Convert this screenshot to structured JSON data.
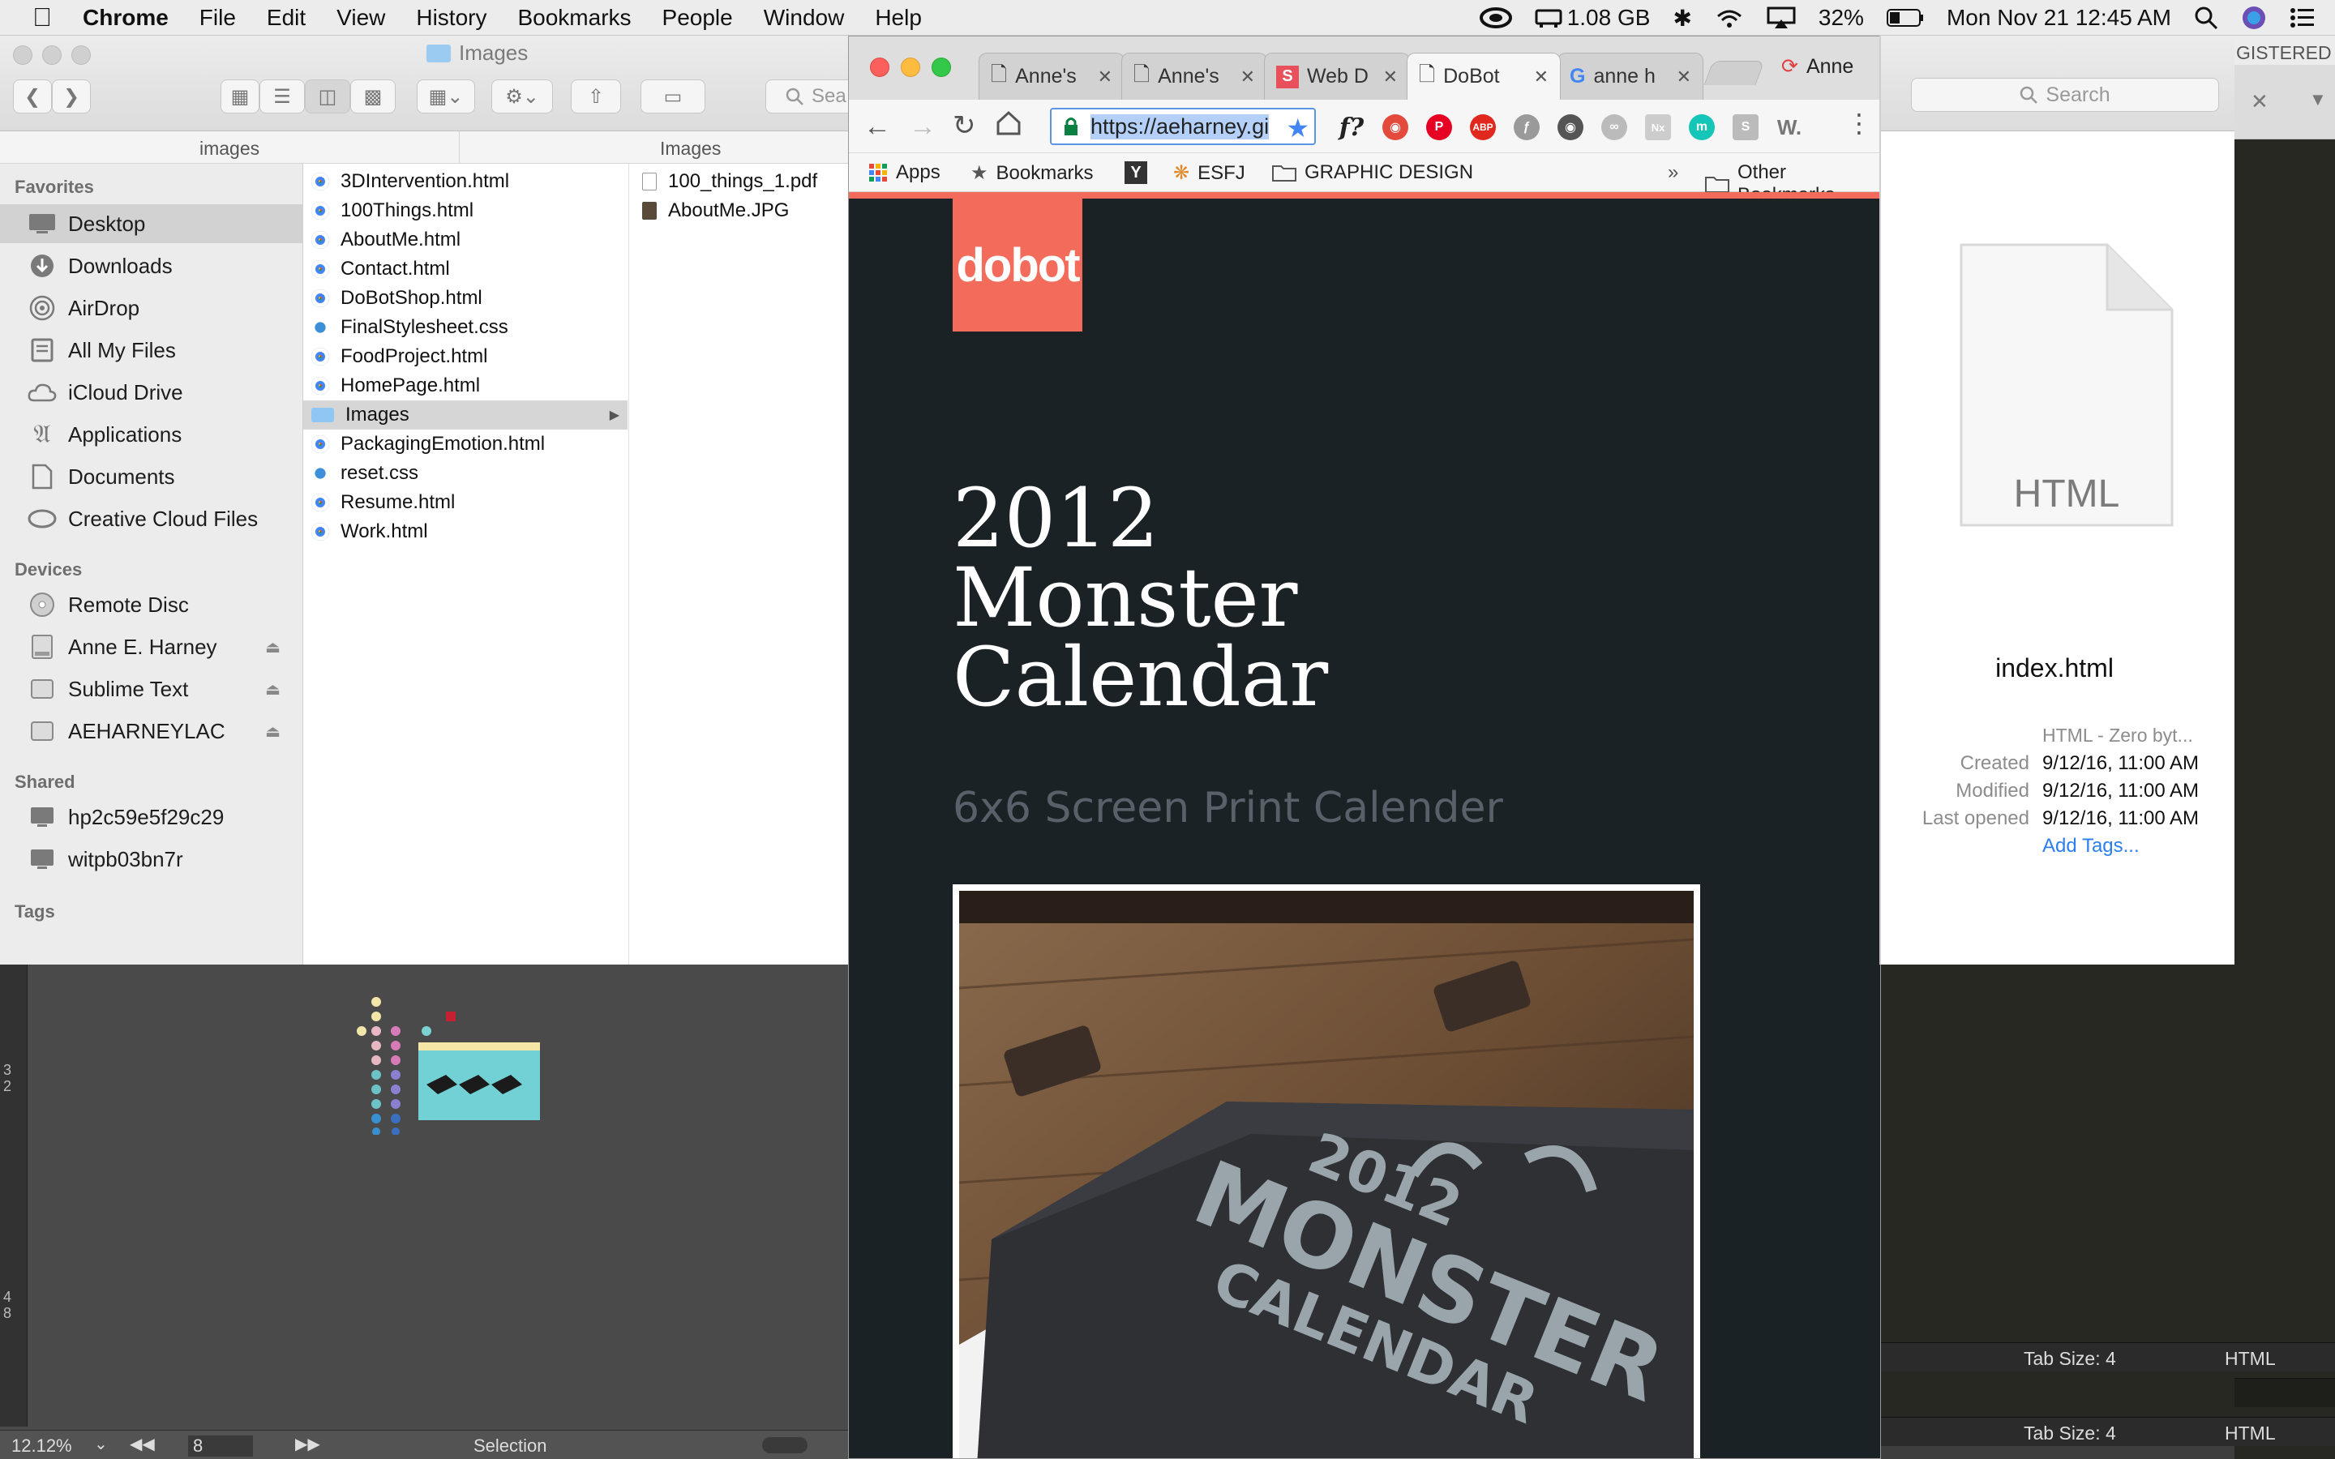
{
  "menubar": {
    "items": [
      "Chrome",
      "File",
      "Edit",
      "View",
      "History",
      "Bookmarks",
      "People",
      "Window",
      "Help"
    ],
    "memory": "1.08 GB",
    "battery": "32%",
    "clock": "Mon Nov 21  12:45 AM"
  },
  "finder": {
    "window_title": "Images",
    "search_placeholder": "Sea",
    "col_headers": [
      "images",
      "Images"
    ],
    "sidebar": {
      "favorites_header": "Favorites",
      "favorites": [
        "Desktop",
        "Downloads",
        "AirDrop",
        "All My Files",
        "iCloud Drive",
        "Applications",
        "Documents",
        "Creative Cloud Files"
      ],
      "devices_header": "Devices",
      "devices": [
        "Remote Disc",
        "Anne E. Harney",
        "Sublime Text",
        "AEHARNEYLAC"
      ],
      "shared_header": "Shared",
      "shared": [
        "hp2c59e5f29c29",
        "witpb03bn7r"
      ],
      "tags_header": "Tags"
    },
    "files": [
      "3DIntervention.html",
      "100Things.html",
      "AboutMe.html",
      "Contact.html",
      "DoBotShop.html",
      "FinalStylesheet.css",
      "FoodProject.html",
      "HomePage.html",
      "Images",
      "PackagingEmotion.html",
      "reset.css",
      "Resume.html",
      "Work.html"
    ],
    "images_files": [
      "100_things_1.pdf",
      "AboutMe.JPG"
    ]
  },
  "preview": {
    "search_placeholder": "Search",
    "doc_label": "HTML",
    "filename": "index.html",
    "kind": "HTML - Zero byt...",
    "rows": [
      {
        "label": "Created",
        "value": "9/12/16, 11:00 AM"
      },
      {
        "label": "Modified",
        "value": "9/12/16, 11:00 AM"
      },
      {
        "label": "Last opened",
        "value": "9/12/16, 11:00 AM"
      }
    ],
    "add_tags": "Add Tags...",
    "registered": "GISTERED"
  },
  "sublime": {
    "tab_size": "Tab Size: 4",
    "syntax": "HTML"
  },
  "illustrator": {
    "zoom": "12.12%",
    "page": "8",
    "mode": "Selection",
    "ruler_marks": [
      "3",
      "2",
      "4",
      "8"
    ]
  },
  "chrome": {
    "profile": "Anne",
    "tabs": [
      {
        "title": "Anne's"
      },
      {
        "title": "Anne's"
      },
      {
        "title": "Web D"
      },
      {
        "title": "DoBot"
      },
      {
        "title": "anne h"
      }
    ],
    "url": "https://aeharney.gi",
    "bookmarks": [
      "Apps",
      "Bookmarks",
      "ESFJ",
      "GRAPHIC DESIGN",
      "Other Bookmarks"
    ],
    "page": {
      "logo": "dobot",
      "title": "2012\nMonster\nCalendar",
      "subtitle": "6x6 Screen Print Calender",
      "photo_text_1": "2012",
      "photo_text_2": "MONSTER",
      "photo_text_3": "CALENDAR"
    }
  }
}
